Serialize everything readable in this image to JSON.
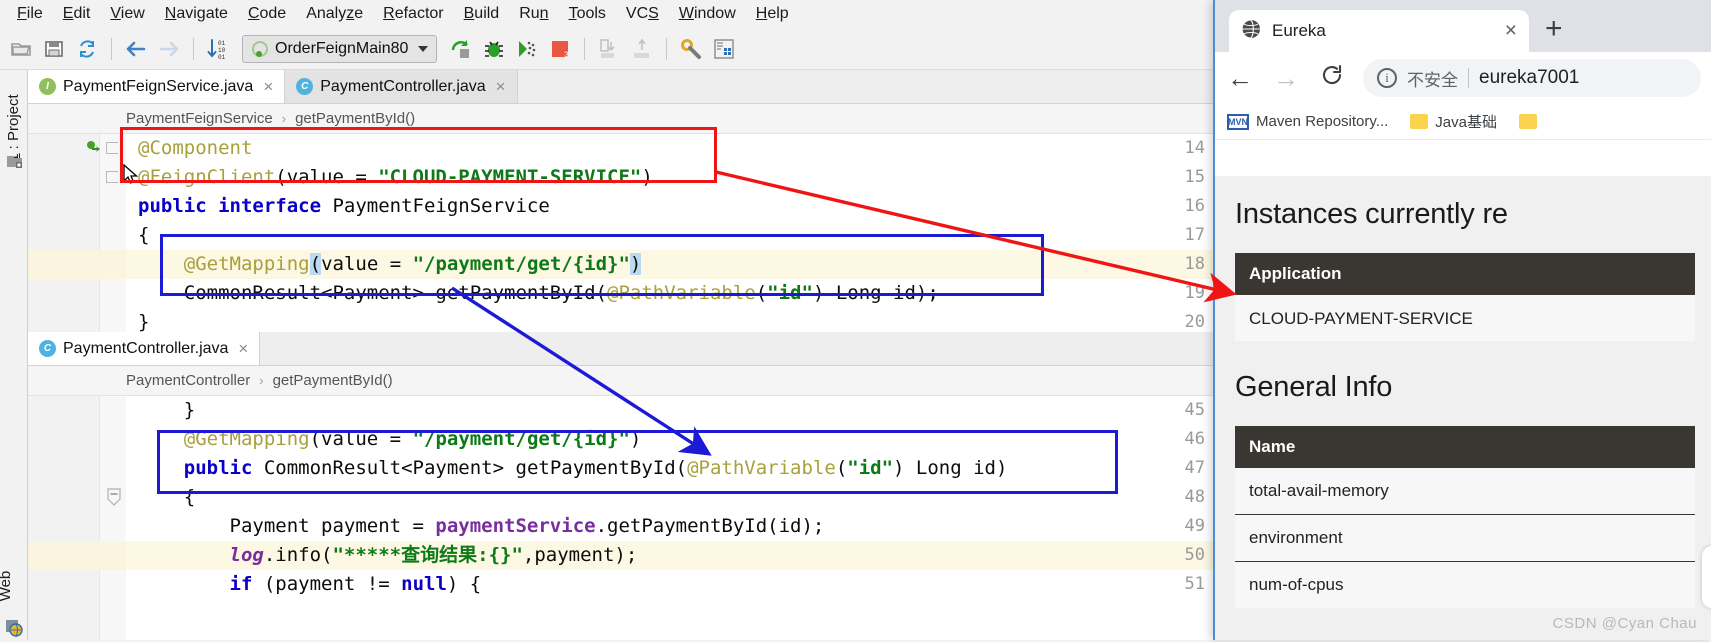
{
  "ide": {
    "menu": [
      {
        "label": "File",
        "mnemonic": "F"
      },
      {
        "label": "Edit",
        "mnemonic": "E"
      },
      {
        "label": "View",
        "mnemonic": "V"
      },
      {
        "label": "Navigate",
        "mnemonic": "N"
      },
      {
        "label": "Code",
        "mnemonic": "C"
      },
      {
        "label": "Analyze",
        "mnemonic": "z"
      },
      {
        "label": "Refactor",
        "mnemonic": "R"
      },
      {
        "label": "Build",
        "mnemonic": "B"
      },
      {
        "label": "Run",
        "mnemonic": "n"
      },
      {
        "label": "Tools",
        "mnemonic": "T"
      },
      {
        "label": "VCS",
        "mnemonic": "S"
      },
      {
        "label": "Window",
        "mnemonic": "W"
      },
      {
        "label": "Help",
        "mnemonic": "H"
      }
    ],
    "toolbar": {
      "run_configuration": "OrderFeignMain80",
      "icons": [
        "open-folder-icon",
        "save-all-icon",
        "sync-refresh-icon",
        "back-arrow-icon",
        "forward-arrow-icon",
        "sort-numeric-icon",
        "run-icon",
        "debug-icon",
        "run-coverage-icon",
        "stop-icon",
        "step-into-icon",
        "step-out-icon",
        "settings-wrench-icon",
        "database-icon",
        "structure-icon"
      ]
    },
    "left_strip": {
      "project_tab": "1: Project",
      "project_tab_index": "1",
      "web_tab": "Web"
    },
    "editors": [
      {
        "tabs": [
          {
            "label": "PaymentFeignService.java",
            "icon": "interface-icon",
            "icon_letter": "I",
            "active": true
          },
          {
            "label": "PaymentController.java",
            "icon": "class-icon",
            "icon_letter": "C",
            "active": false
          }
        ],
        "breadcrumb": [
          "PaymentFeignService",
          "getPaymentById()"
        ],
        "lines": [
          {
            "num": "14",
            "text": "@Component",
            "highlight": false
          },
          {
            "num": "15",
            "text": "@FeignClient(value = \"CLOUD-PAYMENT-SERVICE\")",
            "highlight": false
          },
          {
            "num": "16",
            "text": "public interface PaymentFeignService",
            "highlight": false
          },
          {
            "num": "17",
            "text": "{",
            "highlight": false
          },
          {
            "num": "18",
            "text": "    @GetMapping(value = \"/payment/get/{id}\")",
            "highlight": true
          },
          {
            "num": "19",
            "text": "    CommonResult<Payment> getPaymentById(@PathVariable(\"id\") Long id);",
            "highlight": false
          },
          {
            "num": "20",
            "text": "}",
            "highlight": false
          }
        ]
      },
      {
        "tabs": [
          {
            "label": "PaymentController.java",
            "icon": "class-icon",
            "icon_letter": "C",
            "active": true
          }
        ],
        "breadcrumb": [
          "PaymentController",
          "getPaymentById()"
        ],
        "lines": [
          {
            "num": "45",
            "text": "    }",
            "highlight": false
          },
          {
            "num": "46",
            "text": "    @GetMapping(value = \"/payment/get/{id}\")",
            "highlight": false
          },
          {
            "num": "47",
            "text": "    public CommonResult<Payment> getPaymentById(@PathVariable(\"id\") Long id)",
            "highlight": false
          },
          {
            "num": "48",
            "text": "    {",
            "highlight": false
          },
          {
            "num": "49",
            "text": "        Payment payment = paymentService.getPaymentById(id);",
            "highlight": false
          },
          {
            "num": "50",
            "text": "        log.info(\"*****查询结果:{}\",payment);",
            "highlight": true
          },
          {
            "num": "51",
            "text": "        if (payment != null) {",
            "highlight": false
          }
        ]
      }
    ],
    "annotations": {
      "red_box_label": "feign-client-annotation-highlight",
      "blue_box_label": "get-mapping-signature-highlight",
      "red_arrow_label": "red-arrow-service-name",
      "blue_arrow_label": "blue-arrow-mapping-match"
    }
  },
  "browser": {
    "tab": {
      "title": "Eureka",
      "favicon": "globe-icon",
      "close": "×"
    },
    "new_tab_label": "+",
    "nav": {
      "back": "←",
      "forward": "→",
      "reload": "⟳"
    },
    "omnibox": {
      "info_icon": "i",
      "security_text": "不安全",
      "url": "eureka7001"
    },
    "bookmarks": [
      {
        "label": "Maven Repository...",
        "icon": "maven-icon"
      },
      {
        "label": "Java基础",
        "icon": "folder-icon"
      },
      {
        "label": "",
        "icon": "folder-icon"
      }
    ],
    "page": {
      "heading_instances": "Instances currently re",
      "instances_table": {
        "header": "Application",
        "rows": [
          "CLOUD-PAYMENT-SERVICE"
        ]
      },
      "heading_general": "General Info",
      "general_table": {
        "header": "Name",
        "rows": [
          "total-avail-memory",
          "environment",
          "num-of-cpus"
        ]
      }
    },
    "watermark": "CSDN @Cyan Chau"
  },
  "colors": {
    "annotation_red": "#f01414",
    "annotation_blue": "#1b1bd6",
    "string_green": "#0e7a17",
    "keyword_blue": "#0a00c8",
    "annotation_gold": "#a8a03c",
    "table_header_dark": "#3a3632",
    "browser_accent": "#4a8fd4"
  }
}
